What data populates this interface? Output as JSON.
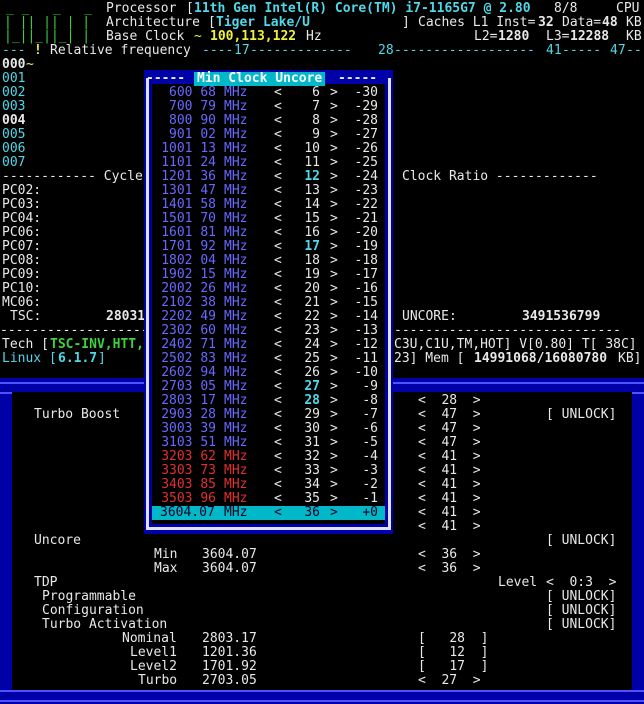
{
  "header": {
    "processor_label": "Processor",
    "processor_value": "11th Gen Intel(R) Core(TM) i7-1165G7 @ 2.80",
    "threads": "8/8",
    "cpu_label": "CPU",
    "arch_label": "Architecture",
    "arch_value": "Tiger Lake/U",
    "caches_label": "Caches L1 Inst=",
    "l1_inst": "32",
    "data_label": "Data=",
    "l1_data": "48",
    "kb1": "KB",
    "base_clock_label": "Base Clock",
    "base_clock_value": "100,113,122",
    "hz": "Hz",
    "l2_label": "L2=",
    "l2_value": "1280",
    "l3_label": "L3=",
    "l3_value": "12288",
    "kb2": "KB",
    "relfreq_label": "Relative frequency",
    "ruler_17": "17",
    "ruler_28": "28",
    "ruler_41": "41",
    "ruler_47": "47",
    "logo_lines": [
      "_ _   _   _",
      "| || || | |",
      "|_||_||_| |"
    ]
  },
  "cores": [
    "000",
    "001",
    "002",
    "003",
    "004",
    "005",
    "006",
    "007"
  ],
  "section_cycles": "------------ Cycle",
  "section_ratio": "Clock Ratio -------------",
  "pc_rows": [
    "PC02:",
    "PC03:",
    "PC04:",
    "PC06:",
    "PC07:",
    "PC08:",
    "PC09:",
    "PC10:",
    "MC06:"
  ],
  "tsc_label": "TSC:",
  "tsc_value": "28031",
  "uncore_label": "UNCORE:",
  "uncore_value": "3491536799",
  "tech_label": "Tech [",
  "tech_items": "TSC-INV,HTT,",
  "tech_right": "C3U,C1U,TM,HOT] V[0.80] T[ 38C]",
  "linux_label": "Linux [",
  "linux_value": "6.1.7",
  "mem_left": "23] Mem [",
  "mem_value": "14991068/16080780",
  "mem_unit": "KB]",
  "popup": {
    "title": "Min Clock Uncore",
    "rows": [
      {
        "freq": "600 68",
        "ratio": "6",
        "offset": "-30",
        "color": "b"
      },
      {
        "freq": "700 79",
        "ratio": "7",
        "offset": "-29",
        "color": "b"
      },
      {
        "freq": "800 90",
        "ratio": "8",
        "offset": "-28",
        "color": "b"
      },
      {
        "freq": "901 02",
        "ratio": "9",
        "offset": "-27",
        "color": "b"
      },
      {
        "freq": "1001 13",
        "ratio": "10",
        "offset": "-26",
        "color": "b"
      },
      {
        "freq": "1101 24",
        "ratio": "11",
        "offset": "-25",
        "color": "b"
      },
      {
        "freq": "1201 36",
        "ratio": "12",
        "offset": "-24",
        "color": "b",
        "hl": true
      },
      {
        "freq": "1301 47",
        "ratio": "13",
        "offset": "-23",
        "color": "b"
      },
      {
        "freq": "1401 58",
        "ratio": "14",
        "offset": "-22",
        "color": "b"
      },
      {
        "freq": "1501 70",
        "ratio": "15",
        "offset": "-21",
        "color": "b"
      },
      {
        "freq": "1601 81",
        "ratio": "16",
        "offset": "-20",
        "color": "b"
      },
      {
        "freq": "1701 92",
        "ratio": "17",
        "offset": "-19",
        "color": "b",
        "hl": true
      },
      {
        "freq": "1802 04",
        "ratio": "18",
        "offset": "-18",
        "color": "b"
      },
      {
        "freq": "1902 15",
        "ratio": "19",
        "offset": "-17",
        "color": "b"
      },
      {
        "freq": "2002 26",
        "ratio": "20",
        "offset": "-16",
        "color": "b"
      },
      {
        "freq": "2102 38",
        "ratio": "21",
        "offset": "-15",
        "color": "b"
      },
      {
        "freq": "2202 49",
        "ratio": "22",
        "offset": "-14",
        "color": "b"
      },
      {
        "freq": "2302 60",
        "ratio": "23",
        "offset": "-13",
        "color": "b"
      },
      {
        "freq": "2402 71",
        "ratio": "24",
        "offset": "-12",
        "color": "b"
      },
      {
        "freq": "2502 83",
        "ratio": "25",
        "offset": "-11",
        "color": "b"
      },
      {
        "freq": "2602 94",
        "ratio": "26",
        "offset": "-10",
        "color": "b"
      },
      {
        "freq": "2703 05",
        "ratio": "27",
        "offset": "-9",
        "color": "b",
        "hl": true
      },
      {
        "freq": "2803 17",
        "ratio": "28",
        "offset": "-8",
        "color": "b",
        "hl": true
      },
      {
        "freq": "2903 28",
        "ratio": "29",
        "offset": "-7",
        "color": "b"
      },
      {
        "freq": "3003 39",
        "ratio": "30",
        "offset": "-6",
        "color": "b"
      },
      {
        "freq": "3103 51",
        "ratio": "31",
        "offset": "-5",
        "color": "b"
      },
      {
        "freq": "3203 62",
        "ratio": "32",
        "offset": "-4",
        "color": "r"
      },
      {
        "freq": "3303 73",
        "ratio": "33",
        "offset": "-3",
        "color": "r"
      },
      {
        "freq": "3403 85",
        "ratio": "34",
        "offset": "-2",
        "color": "r"
      },
      {
        "freq": "3503 96",
        "ratio": "35",
        "offset": "-1",
        "color": "r"
      }
    ],
    "unit": "MHz",
    "selected": {
      "freq": "3604.07",
      "unit": "MHz",
      "ratio": "36",
      "offset": "+0"
    }
  },
  "settings": {
    "turbo_boost_label": "Turbo Boost",
    "unlock": "[ UNLOCK]",
    "right_ratios": [
      "28",
      "47",
      "47",
      "47",
      "41",
      "41",
      "41",
      "41",
      "41",
      "41"
    ],
    "uncore_label": "Uncore",
    "min_label": "Min",
    "min_value": "3604.07",
    "min_ratio": "36",
    "max_label": "Max",
    "max_value": "3604.07",
    "max_ratio": "36",
    "tdp_label": "TDP",
    "level_label": "Level",
    "level_value": "0:3",
    "programmable_label": "Programmable",
    "configuration_label": "Configuration",
    "turbo_activation_label": "Turbo Activation",
    "nominal_label": "Nominal",
    "nominal_value": "2803.17",
    "nominal_ratio": "28",
    "level1_label": "Level1",
    "level1_value": "1201.36",
    "level1_ratio": "12",
    "level2_label": "Level2",
    "level2_value": "1701.92",
    "level2_ratio": "17",
    "turbo_label": "Turbo",
    "turbo_value": "2703.05",
    "turbo_ratio": "27"
  }
}
